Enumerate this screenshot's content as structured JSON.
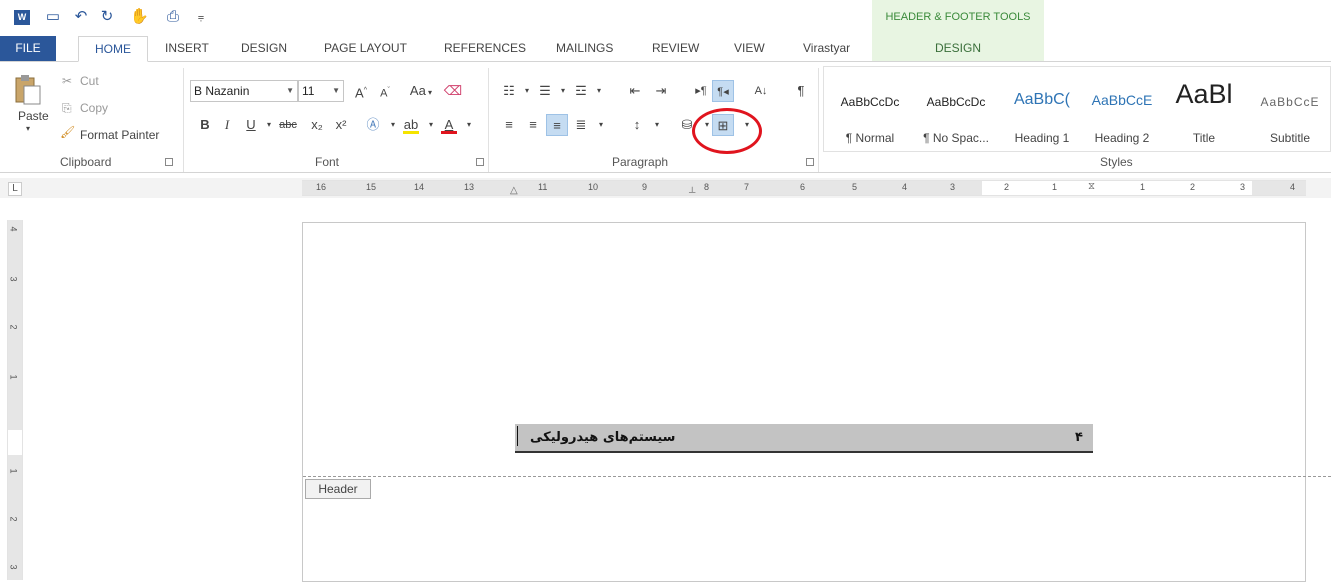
{
  "quick_access": {
    "app_icon": "word-icon",
    "app_icon_text": "W",
    "icons": [
      "save-icon",
      "undo-icon",
      "redo-icon",
      "touch-mode-icon",
      "print-preview-icon",
      "customize-icon"
    ],
    "context_group": "HEADER & FOOTER TOOLS"
  },
  "tabs": [
    "FILE",
    "HOME",
    "INSERT",
    "DESIGN",
    "PAGE LAYOUT",
    "REFERENCES",
    "MAILINGS",
    "REVIEW",
    "VIEW",
    "Virastyar"
  ],
  "context_tab": "DESIGN",
  "clipboard": {
    "paste": "Paste",
    "cut": "Cut",
    "copy": "Copy",
    "format_painter": "Format Painter",
    "group": "Clipboard"
  },
  "font": {
    "name": "B Nazanin",
    "size": "11",
    "change_case": "Aa",
    "bold": "B",
    "italic": "I",
    "underline": "U",
    "strike": "abc",
    "subscript": "x₂",
    "superscript": "x²",
    "group": "Font",
    "font_color": "#e0141e",
    "highlight_color": "#f5e400"
  },
  "paragraph": {
    "group": "Paragraph",
    "sort": "A↓",
    "pilcrow": "¶"
  },
  "styles": {
    "group": "Styles",
    "items": [
      {
        "sample": "AaBbCcDc",
        "name": "¶ Normal"
      },
      {
        "sample": "AaBbCcDc",
        "name": "¶ No Spac..."
      },
      {
        "sample": "AaBbC(",
        "name": "Heading 1"
      },
      {
        "sample": "AaBbCcE",
        "name": "Heading 2"
      },
      {
        "sample": "AaBl",
        "name": "Title"
      },
      {
        "sample": "AaBbCcE",
        "name": "Subtitle"
      }
    ]
  },
  "ruler": {
    "corner": "L",
    "h_numbers": [
      "16",
      "15",
      "14",
      "13",
      "11",
      "10",
      "9",
      "8",
      "7",
      "6",
      "5",
      "4",
      "3",
      "2",
      "1",
      "1",
      "2",
      "3",
      "4"
    ],
    "v_numbers": [
      "4",
      "3",
      "2",
      "1",
      "1",
      "2",
      "3"
    ]
  },
  "document": {
    "header_title": "سیستم‌های هیدرولیکی",
    "page_number": "۴",
    "header_tag": "Header"
  }
}
